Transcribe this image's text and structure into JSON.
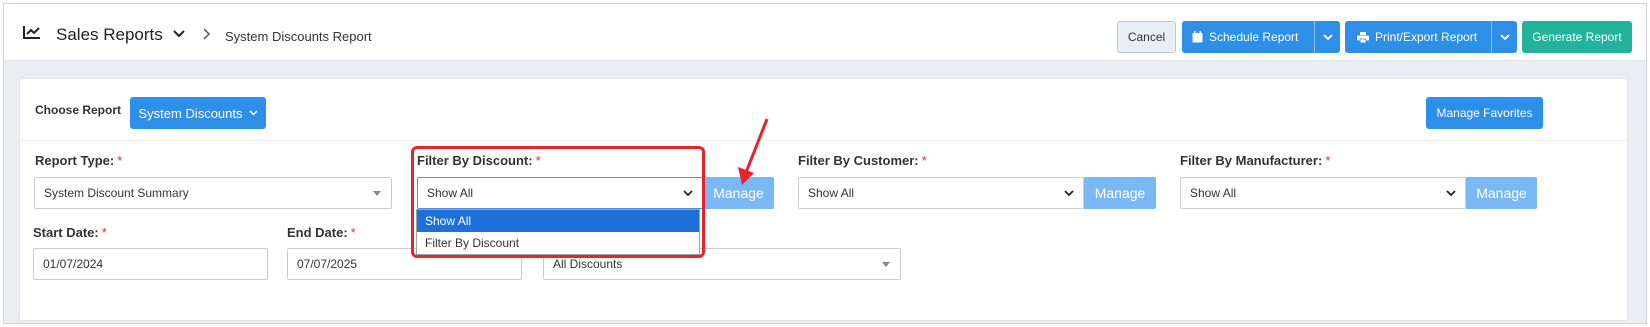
{
  "header": {
    "title": "Sales Reports",
    "breadcrumb": "System Discounts Report",
    "cancel_label": "Cancel",
    "schedule_label": "Schedule Report",
    "print_label": "Print/Export Report",
    "generate_label": "Generate Report"
  },
  "card": {
    "choose_label": "Choose Report",
    "choose_value": "System Discounts",
    "favorites_label": "Manage Favorites"
  },
  "filters": {
    "report_type_label": "Report Type:",
    "report_type_value": "System Discount Summary",
    "discount_label": "Filter By Discount:",
    "discount_value": "Show All",
    "customer_label": "Filter By Customer:",
    "customer_value": "Show All",
    "manufacturer_label": "Filter By Manufacturer:",
    "manufacturer_value": "Show All",
    "manage_label": "Manage",
    "start_label": "Start Date:",
    "start_value": "01/07/2024",
    "end_label": "End Date:",
    "end_value": "07/07/2025",
    "discounts_value": "All Discounts",
    "required_mark": "*"
  },
  "dropdown": {
    "options": [
      "Show All",
      "Filter By Discount"
    ]
  },
  "colors": {
    "primary": "#2d8fe8",
    "teal": "#23b39a",
    "manage": "#7ab8f5",
    "highlight": "#e8232b",
    "selected": "#1f6fd9"
  }
}
